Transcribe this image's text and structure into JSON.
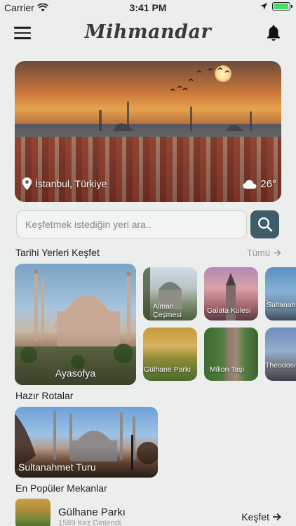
{
  "status_bar": {
    "carrier": "Carrier",
    "time": "3:41 PM",
    "battery_level": 0.95
  },
  "header": {
    "title": "Mihmandar"
  },
  "hero": {
    "location": "İstanbul, Türkiye",
    "temperature": "26°"
  },
  "search": {
    "placeholder": "Keşfetmek istediğin yeri ara.."
  },
  "historic_section": {
    "title": "Tarihi Yerleri Keşfet",
    "see_all": "Tümü",
    "featured": {
      "name": "Ayasofya"
    },
    "places": [
      {
        "name": "Alman Çeşmesi"
      },
      {
        "name": "Galata Kulesi"
      },
      {
        "name": "Sultanahmet Camii"
      },
      {
        "name": "Gülhane Parkı"
      },
      {
        "name": "Milion Taşı"
      },
      {
        "name": "Theodosius Dikilitaşı"
      }
    ]
  },
  "routes_section": {
    "title": "Hazır Rotalar",
    "routes": [
      {
        "name": "Sultanahmet Turu"
      }
    ]
  },
  "popular_section": {
    "title": "En Popüler Mekanlar",
    "items": [
      {
        "name": "Gülhane Parkı",
        "listens": "1589 Kez Dinlendi",
        "action": "Keşfet"
      }
    ]
  },
  "colors": {
    "accent": "#3f5d69",
    "background": "#eceeee"
  }
}
